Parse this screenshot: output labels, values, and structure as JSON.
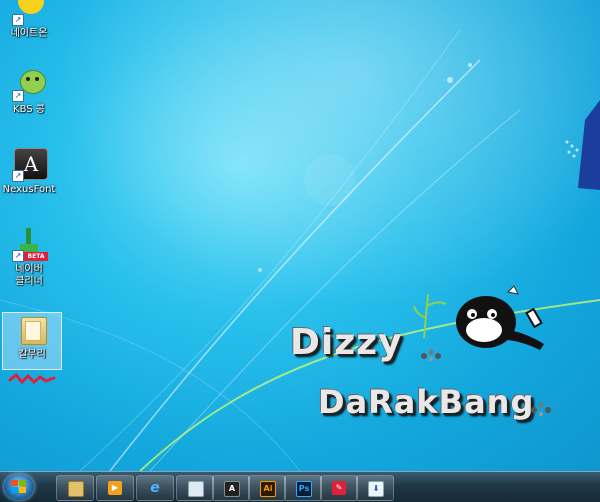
{
  "desktop": {
    "icons": [
      {
        "label": "네이트온"
      },
      {
        "label": "KBS 콩"
      },
      {
        "label": "NexusFont"
      },
      {
        "label": "네이버\n클리너"
      },
      {
        "label": "칼무리"
      }
    ],
    "wordmark_line1": "Dizzy",
    "wordmark_line2": "DaRakBang",
    "beta_badge": "BETA"
  },
  "taskbar": {
    "pinned": [
      {
        "name": "explorer"
      },
      {
        "name": "media-player"
      },
      {
        "name": "internet-explorer"
      },
      {
        "name": "notepad"
      },
      {
        "name": "nexusfont"
      },
      {
        "name": "illustrator",
        "glyph": "Ai"
      },
      {
        "name": "photoshop",
        "glyph": "Ps"
      },
      {
        "name": "paint"
      },
      {
        "name": "downloader"
      }
    ]
  },
  "colors": {
    "desktop": "#1fb3e6",
    "taskbar": "#1f3848",
    "accent_red": "#e0203a"
  }
}
